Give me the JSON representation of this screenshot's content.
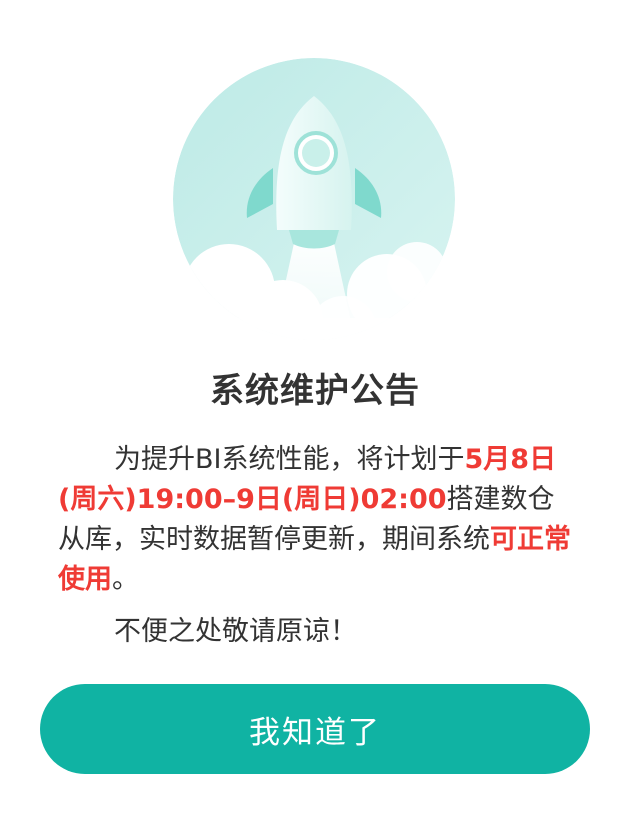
{
  "dialog": {
    "title": "系统维护公告",
    "message": {
      "part1": "为提升BI系统性能，将计划于",
      "highlight1": "5月8日(周六)19:00–9日(周日)02:00",
      "part2": "搭建数仓从库，实时数据暂停更新，期间系统",
      "highlight2": "可正常使用",
      "part3": "。"
    },
    "closing": "不便之处敬请原谅！",
    "confirm_label": "我知道了"
  },
  "colors": {
    "accent": "#10b3a3",
    "highlight": "#ef3b35",
    "text": "#333333",
    "illustration_bg": "#c8efec"
  },
  "icons": {
    "hero": "rocket-icon"
  }
}
